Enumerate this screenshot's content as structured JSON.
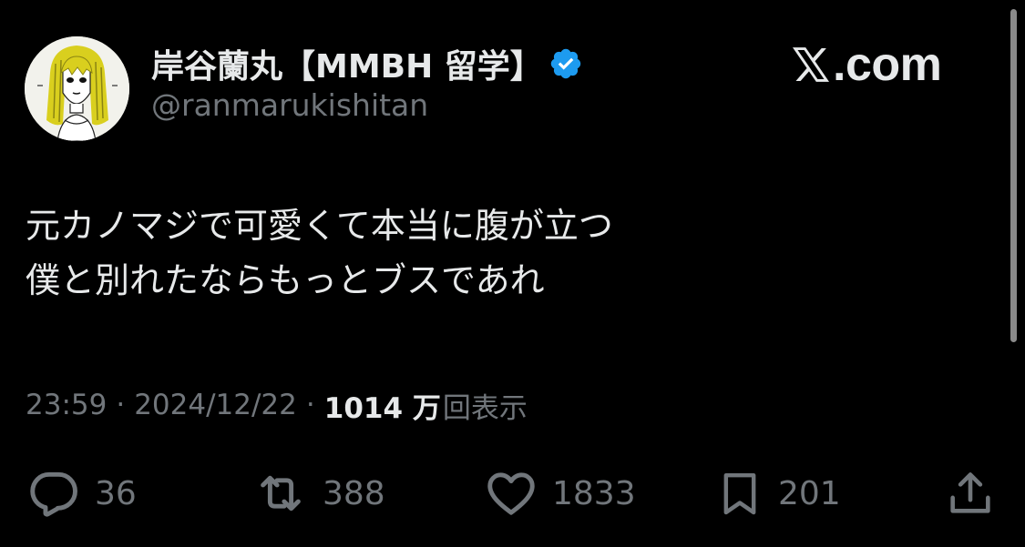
{
  "user": {
    "display_name": "岸谷蘭丸【MMBH 留学】",
    "handle": "@ranmarukishitan",
    "verified": true,
    "avatar": "illustrated-portrait-avatar"
  },
  "brand": {
    "logo_text": ".com",
    "logo_icon": "x-logo-icon"
  },
  "tweet": {
    "lines": [
      "元カノマジで可愛くて本当に腹が立つ",
      "僕と別れたならもっとブスであれ"
    ]
  },
  "meta": {
    "time": "23:59",
    "separator": "·",
    "date": "2024/12/22",
    "views_count": "1014 万",
    "views_label": "回表示"
  },
  "actions": {
    "replies": {
      "icon": "reply-icon",
      "count": "36"
    },
    "reposts": {
      "icon": "repost-icon",
      "count": "388"
    },
    "likes": {
      "icon": "like-icon",
      "count": "1833"
    },
    "bookmarks": {
      "icon": "bookmark-icon",
      "count": "201"
    },
    "share": {
      "icon": "share-icon"
    }
  },
  "colors": {
    "background": "#000000",
    "primary_text": "#e7e9ea",
    "secondary_text": "#71767b",
    "verified_blue": "#1d9bf0",
    "avatar_hair_yellow": "#d9cf1e"
  }
}
